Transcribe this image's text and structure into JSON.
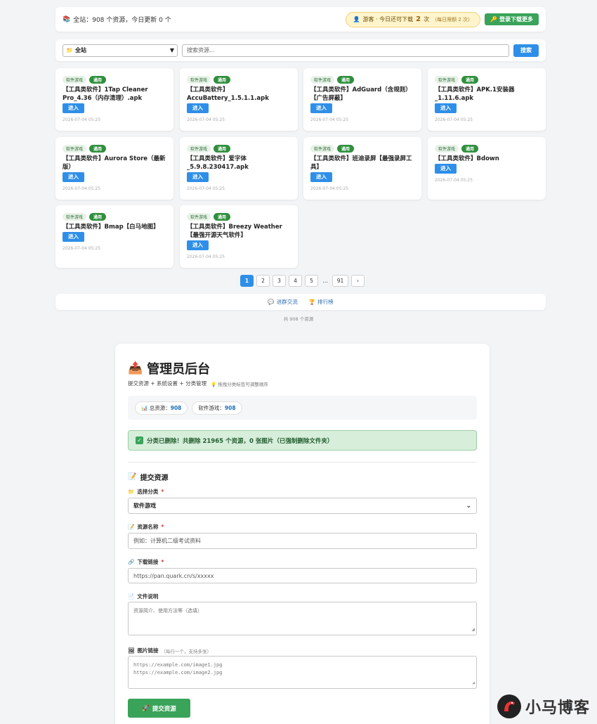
{
  "topbar": {
    "stats_text": "全站：908 个资源，今日更新 0 个",
    "guest_prefix": "游客 · 今日还可下载",
    "guest_count": "2",
    "guest_suffix": "次",
    "guest_note": "（每日限额 2 次）",
    "login_label": "登录下载更多"
  },
  "search": {
    "category_selected": "全站",
    "placeholder": "搜索资源...",
    "button_label": "搜索"
  },
  "cards": [
    {
      "category": "软件游戏",
      "badge": "通用",
      "title": "【工具类软件】1Tap Cleaner Pro_4.36（内存清理）.apk",
      "button": "进入",
      "time": "2026-07-04 05:25"
    },
    {
      "category": "软件游戏",
      "badge": "通用",
      "title": "【工具类软件】AccuBattery_1.5.1.1.apk",
      "button": "进入",
      "time": "2026-07-04 05:25"
    },
    {
      "category": "软件游戏",
      "badge": "通用",
      "title": "【工具类软件】AdGuard（含规则）【广告屏蔽】",
      "button": "进入",
      "time": "2026-07-04 05:25"
    },
    {
      "category": "软件游戏",
      "badge": "通用",
      "title": "【工具类软件】APK.1安装器_1.11.6.apk",
      "button": "进入",
      "time": "2026-07-04 05:25"
    },
    {
      "category": "软件游戏",
      "badge": "通用",
      "title": "【工具类软件】Aurora Store（最新版）",
      "button": "进入",
      "time": "2026-07-04 05:25"
    },
    {
      "category": "软件游戏",
      "badge": "通用",
      "title": "【工具类软件】爱字体_5.9.8.230417.apk",
      "button": "进入",
      "time": "2026-07-04 05:25"
    },
    {
      "category": "软件游戏",
      "badge": "通用",
      "title": "【工具类软件】班迪录屏【最强录屏工具】",
      "button": "进入",
      "time": "2026-07-04 05:25"
    },
    {
      "category": "软件游戏",
      "badge": "通用",
      "title": "【工具类软件】Bdown",
      "button": "进入",
      "time": "2026-07-04 05:25"
    },
    {
      "category": "软件游戏",
      "badge": "通用",
      "title": "【工具类软件】Bmap【白马地图】",
      "button": "进入",
      "time": "2026-07-04 05:25"
    },
    {
      "category": "软件游戏",
      "badge": "通用",
      "title": "【工具类软件】Breezy Weather【最强开源天气软件】",
      "button": "进入",
      "time": "2026-07-04 05:25"
    }
  ],
  "pagination": {
    "pages": [
      "1",
      "2",
      "3",
      "4",
      "5"
    ],
    "ellipsis": "...",
    "last": "91",
    "next": "›"
  },
  "footer": {
    "group_link": "进群交流",
    "rank_link": "排行榜",
    "total_text": "共 908 个资源"
  },
  "admin": {
    "title": "管理员后台",
    "subtitle": "提交资源 + 系统设置 + 分类管理",
    "hint": "拖拽分类标签可调整顺序",
    "stat_total_label": "总资源：",
    "stat_total_value": "908",
    "stat_cat_label": "软件游戏：",
    "stat_cat_value": "908",
    "alert_text": "分类已删除！共删除 21965 个资源，0 张图片（已强制删除文件夹）",
    "section_title": "提交资源",
    "category_label": "选择分类",
    "category_value": "软件游戏",
    "name_label": "资源名称",
    "name_placeholder": "例如：计算机二级考试资料",
    "link_label": "下载链接",
    "link_placeholder": "https://pan.quark.cn/s/xxxxx",
    "desc_label": "文件说明",
    "desc_placeholder": "资源简介、使用方法等（选填）",
    "img_label": "图片链接",
    "img_note": "（每行一个，支持多张）",
    "img_placeholder_1": "https://example.com/image1.jpg",
    "img_placeholder_2": "https://example.com/image2.jpg",
    "submit_label": "提交资源",
    "required_mark": "*"
  },
  "brand": {
    "name": "小马博客"
  },
  "colors": {
    "primary_blue": "#2f8fe8",
    "success_green": "#3aa35a",
    "guest_yellow": "#fff4cc"
  }
}
